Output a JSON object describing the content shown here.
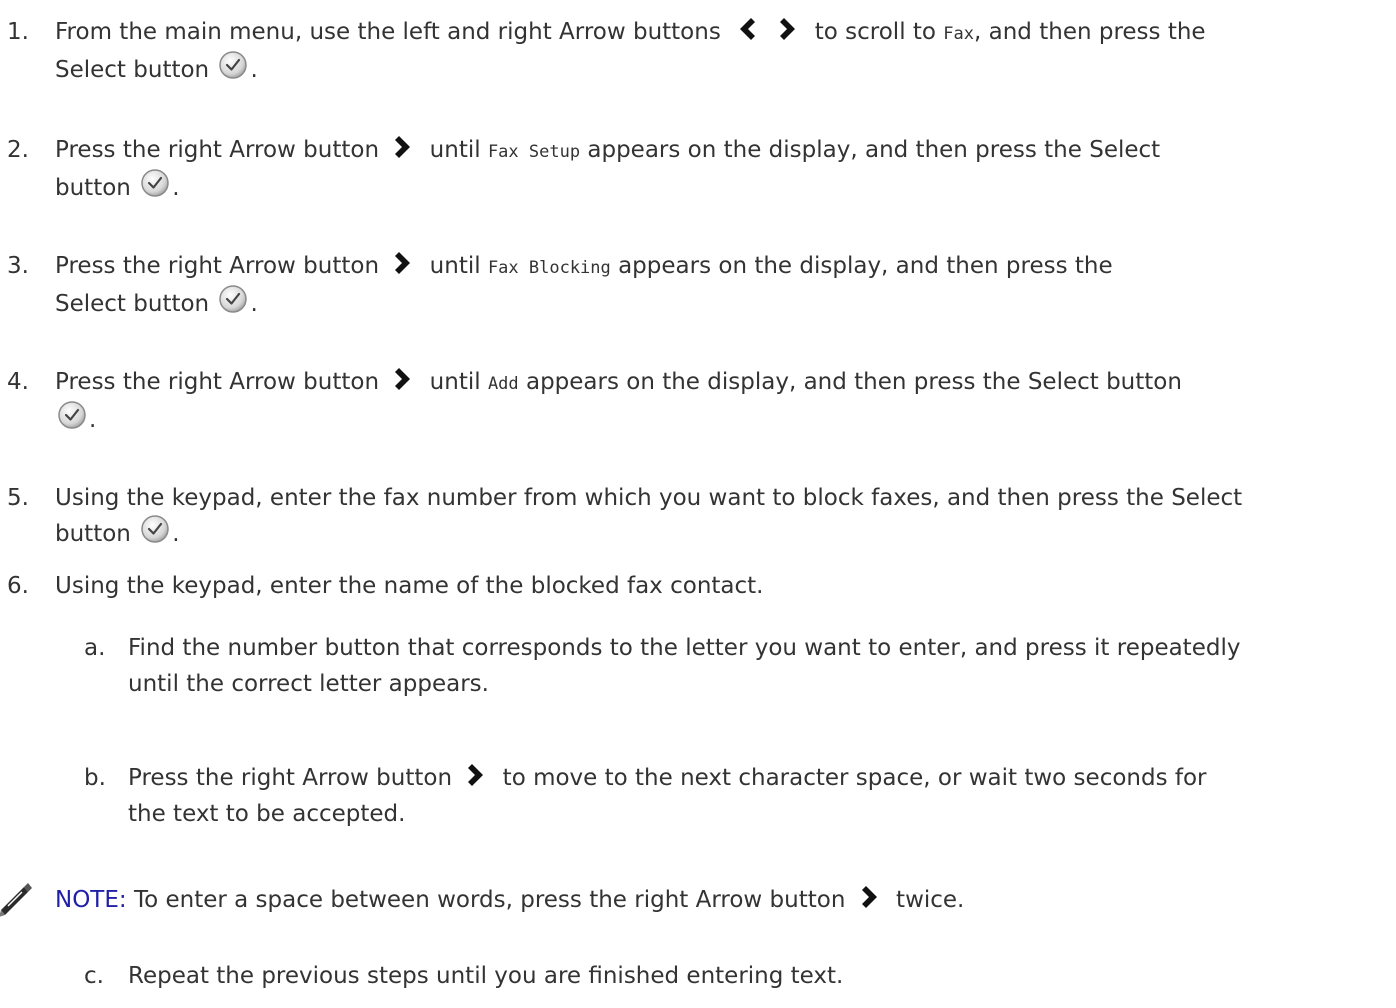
{
  "steps": [
    {
      "num": "1.",
      "a": "From the main menu, use the left and right Arrow buttons",
      "b": "to scroll to",
      "code": "Fax",
      "c": ", and then press the",
      "d": "Select button",
      "e": "."
    },
    {
      "num": "2.",
      "a": "Press the right Arrow button",
      "b": "until",
      "code": "Fax Setup",
      "c": "appears on the display, and then press the Select",
      "d": "button",
      "e": "."
    },
    {
      "num": "3.",
      "a": "Press the right Arrow button",
      "b": "until",
      "code": "Fax Blocking",
      "c": "appears on the display,  and then press the",
      "d": "Select button",
      "e": "."
    },
    {
      "num": "4.",
      "a": "Press the right Arrow button",
      "b": "until",
      "code": "Add",
      "c": "appears on the display, and then press the Select button",
      "e": "."
    },
    {
      "num": "5.",
      "a": "Using the keypad, enter the fax number from which you want to block faxes, and then press the Select",
      "d": "button",
      "e": "."
    },
    {
      "num": "6.",
      "a": "Using the keypad, enter the name of the blocked fax contact."
    }
  ],
  "substeps": [
    {
      "letter": "a.",
      "line1": "Find the number button that corresponds to the letter you want to enter, and press it repeatedly",
      "line2": "until the correct letter appears."
    },
    {
      "letter": "b.",
      "line1a": "Press the right Arrow button",
      "line1b": "to move to the next character space, or wait two seconds for",
      "line2": "the text to be accepted."
    },
    {
      "letter": "c.",
      "line1": "Repeat the previous steps until you are finished entering text."
    }
  ],
  "note": {
    "label": "NOTE:",
    "text_a": "To enter a space between words, press the right Arrow button",
    "text_b": "twice."
  },
  "icons": {
    "left_arrow": "left-arrow-icon",
    "right_arrow": "right-arrow-icon",
    "select": "select-check-icon",
    "note": "note-pencil-icon"
  },
  "colors": {
    "note_label": "#1f1fa8",
    "text": "#333333"
  }
}
